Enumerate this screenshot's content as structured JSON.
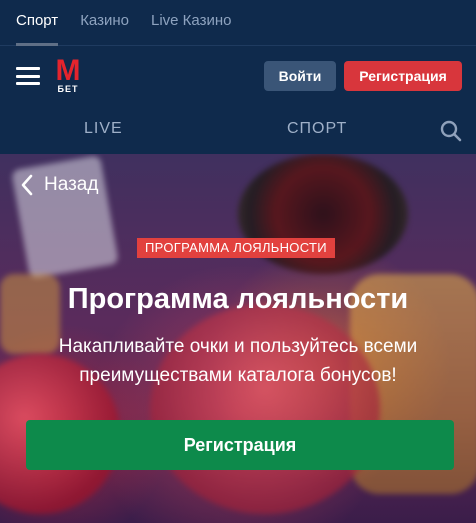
{
  "top_tabs": [
    {
      "label": "Спорт",
      "active": true
    },
    {
      "label": "Казино",
      "active": false
    },
    {
      "label": "Live Казино",
      "active": false
    }
  ],
  "header": {
    "logo_letter": "М",
    "logo_sub": "БЕТ",
    "login_label": "Войти",
    "register_label": "Регистрация",
    "brand_color": "#e4242d"
  },
  "nav": {
    "live_label": "LIVE",
    "sport_label": "СПОРТ",
    "search_icon": "search-icon"
  },
  "hero": {
    "back_label": "Назад",
    "badge": "ПРОГРАММА ЛОЯЛЬНОСТИ",
    "title": "Программа лояльности",
    "subtitle": "Накапливайте очки и пользуйтесь всеми преимуществами каталога бонусов!",
    "cta_label": "Регистрация",
    "cta_color": "#0d8a4b"
  }
}
